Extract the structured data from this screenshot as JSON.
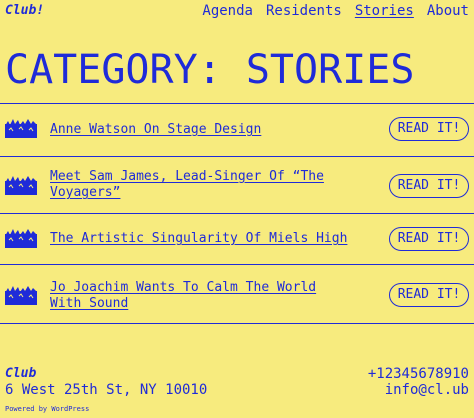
{
  "header": {
    "logo": "Club!",
    "nav": [
      {
        "label": "Agenda",
        "active": false
      },
      {
        "label": "Residents",
        "active": false
      },
      {
        "label": "Stories",
        "active": true
      },
      {
        "label": "About",
        "active": false
      }
    ]
  },
  "page_title": "CATEGORY: STORIES",
  "posts": [
    {
      "title": "Anne Watson On Stage Design",
      "button": "READ IT!",
      "thumb_icon": "crowd-image-icon"
    },
    {
      "title": "Meet Sam James, Lead-Singer Of “The Voyagers”",
      "button": "READ IT!",
      "thumb_icon": "crowd-image-icon"
    },
    {
      "title": "The Artistic Singularity Of Miels High",
      "button": "READ IT!",
      "thumb_icon": "crowd-image-icon"
    },
    {
      "title": "Jo Joachim Wants To Calm The World With Sound",
      "button": "READ IT!",
      "thumb_icon": "crowd-image-icon"
    }
  ],
  "footer": {
    "name": "Club",
    "address": "6 West 25th St, NY 10010",
    "phone": "+12345678910",
    "email": "info@cl.ub",
    "powered": "Powered by WordPress"
  },
  "colors": {
    "background": "#f7eb7e",
    "accent": "#1f2bd8"
  }
}
